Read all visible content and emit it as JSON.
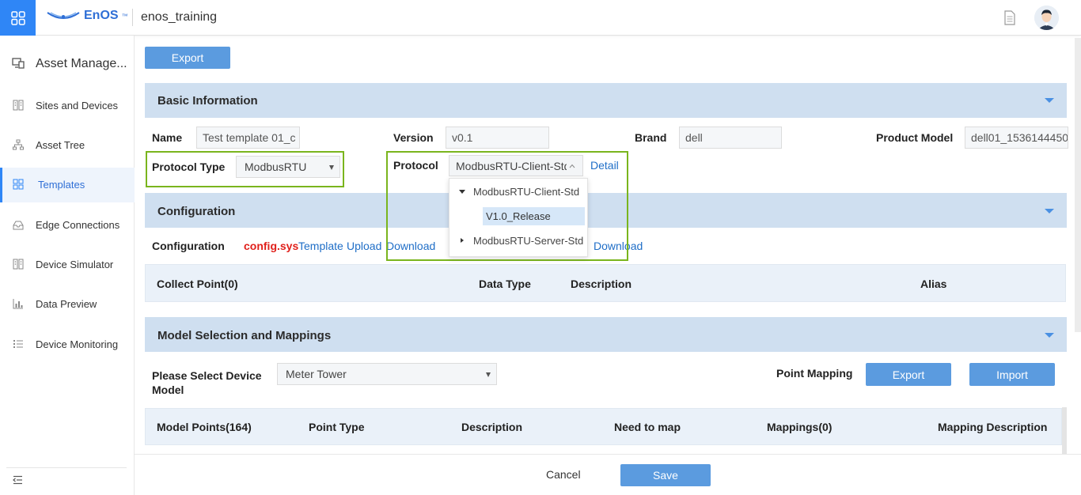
{
  "header": {
    "logo_text": "EnOS",
    "logo_tm": "™",
    "org_name": "enos_training"
  },
  "sidebar": {
    "title": "Asset Manage...",
    "items": [
      {
        "label": "Sites and Devices"
      },
      {
        "label": "Asset Tree"
      },
      {
        "label": "Templates"
      },
      {
        "label": "Edge Connections"
      },
      {
        "label": "Device Simulator"
      },
      {
        "label": "Data Preview"
      },
      {
        "label": "Device Monitoring"
      }
    ],
    "active_item": "Templates"
  },
  "toolbar": {
    "export_label": "Export"
  },
  "basic_info": {
    "title": "Basic Information",
    "name_label": "Name",
    "name_value": "Test template 01_c",
    "version_label": "Version",
    "version_value": "v0.1",
    "brand_label": "Brand",
    "brand_value": "dell",
    "product_model_label": "Product Model",
    "product_model_value": "dell01_1536144450",
    "protocol_type_label": "Protocol Type",
    "protocol_type_value": "ModbusRTU",
    "protocol_label": "Protocol",
    "protocol_value": "ModbusRTU-Client-Std",
    "detail_link": "Detail"
  },
  "protocol_dropdown": {
    "items": [
      {
        "label": "ModbusRTU-Client-Std",
        "expanded": true,
        "children": [
          "V1.0_Release"
        ]
      },
      {
        "label": "ModbusRTU-Server-Std",
        "expanded": false
      }
    ],
    "selected": "V1.0_Release"
  },
  "configuration": {
    "title": "Configuration",
    "row_label": "Configuration",
    "file_name": "config.sys",
    "template_link": "Template",
    "upload_link": "Upload",
    "download_link": "Download",
    "download_link_2": "Download",
    "columns": [
      "Collect Point(0)",
      "Data Type",
      "Description",
      "Alias"
    ]
  },
  "model_section": {
    "title": "Model Selection and Mappings",
    "select_label": "Please Select Device Model",
    "device_model_value": "Meter Tower",
    "point_mapping_label": "Point Mapping",
    "export_label": "Export",
    "import_label": "Import",
    "columns": [
      "Model Points(164)",
      "Point Type",
      "Description",
      "Need to map",
      "Mappings(0)",
      "Mapping Description"
    ]
  },
  "footer": {
    "cancel_label": "Cancel",
    "save_label": "Save"
  },
  "colors": {
    "accent": "#2f86f6",
    "button": "#5b9bdf",
    "section_header": "#cfdff0",
    "highlight_border": "#7ab51d",
    "link": "#1f6ec7",
    "file_red": "#e0201b"
  }
}
